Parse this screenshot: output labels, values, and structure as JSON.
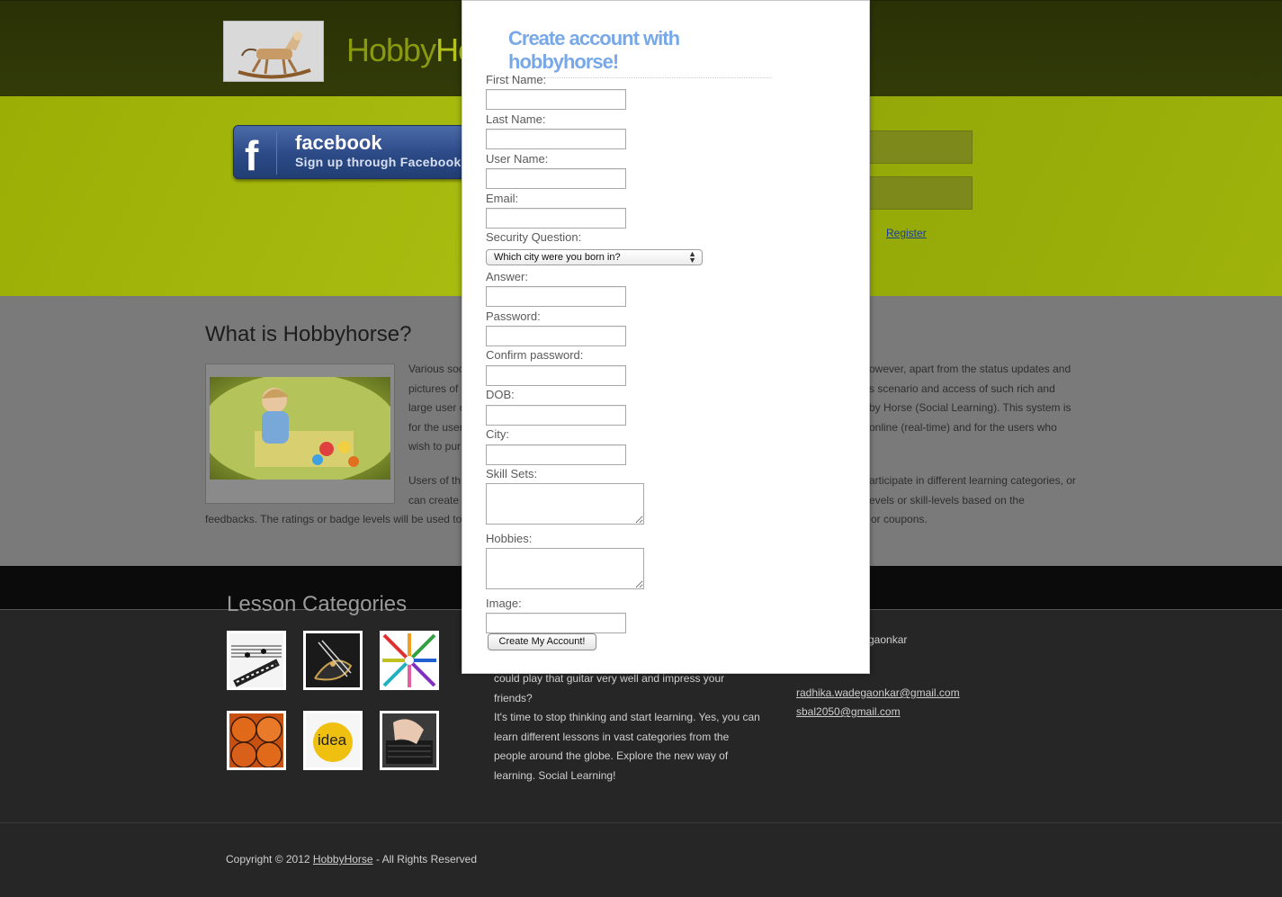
{
  "brand": {
    "name_part1": "Hobby",
    "name_part2": "Ho"
  },
  "facebook": {
    "title": "facebook",
    "subtitle": "Sign up through Facebook",
    "icon": "f"
  },
  "login": {
    "register_label": "Register"
  },
  "about": {
    "title": "What is Hobbyhorse?",
    "para1_lines": [
      "Various soc",
      "pictures of",
      "large user c",
      "for the user",
      "wish to pur"
    ],
    "para1_right_lines": [
      "owever, apart from the status updates and",
      "s scenario and access of such rich and",
      "by Horse (Social Learning). This system is",
      "online (real-time) and for the users who"
    ],
    "para2_lines": [
      "Users of th",
      "can create"
    ],
    "para2_right_lines": [
      "articipate in different learning categories, or",
      "evels or skill-levels based on the"
    ],
    "para2_last_left": "feedbacks. The ratings or badge levels will be used to",
    "para2_last_right": "or coupons."
  },
  "footer": {
    "lesson_title": "Lesson Categories",
    "categories": [
      {
        "name": "music-category-icon"
      },
      {
        "name": "guitar-category-icon"
      },
      {
        "name": "art-category-icon"
      },
      {
        "name": "sports-category-icon"
      },
      {
        "name": "idea-category-icon",
        "label": "idea"
      },
      {
        "name": "technology-category-icon"
      }
    ],
    "text_lines": [
      "could play that guitar very well and impress your",
      "friends?",
      "It's time to stop thinking and start learning. Yes, you can",
      "learn different lessons in vast categories from the",
      "people around the globe. Explore the new way of",
      "learning. Social Learning!"
    ],
    "contact_name_fragment": "gaonkar",
    "emails": [
      "radhika.wadegaonkar@gmail.com",
      "sbal2050@gmail.com"
    ],
    "copyright_prefix": "Copyright © 2012 ",
    "copyright_link": "HobbyHorse",
    "copyright_suffix": " - All Rights Reserved"
  },
  "modal": {
    "title": "Create account with hobbyhorse!",
    "fields": {
      "first_name": "First Name:",
      "last_name": "Last Name:",
      "user_name": "User Name:",
      "email": "Email:",
      "security_question": "Security Question:",
      "answer": "Answer:",
      "password": "Password:",
      "confirm_password": "Confirm password:",
      "dob": "DOB:",
      "city": "City:",
      "skill_sets": "Skill Sets:",
      "hobbies": "Hobbies:",
      "image": "Image:"
    },
    "security_selected": "Which city were you born in?",
    "submit_label": "Create My Account!"
  },
  "colors": {
    "header": "#2e3607",
    "band": "#9fb30b",
    "modal_title": "#78a8e8",
    "footer": "#262626"
  }
}
